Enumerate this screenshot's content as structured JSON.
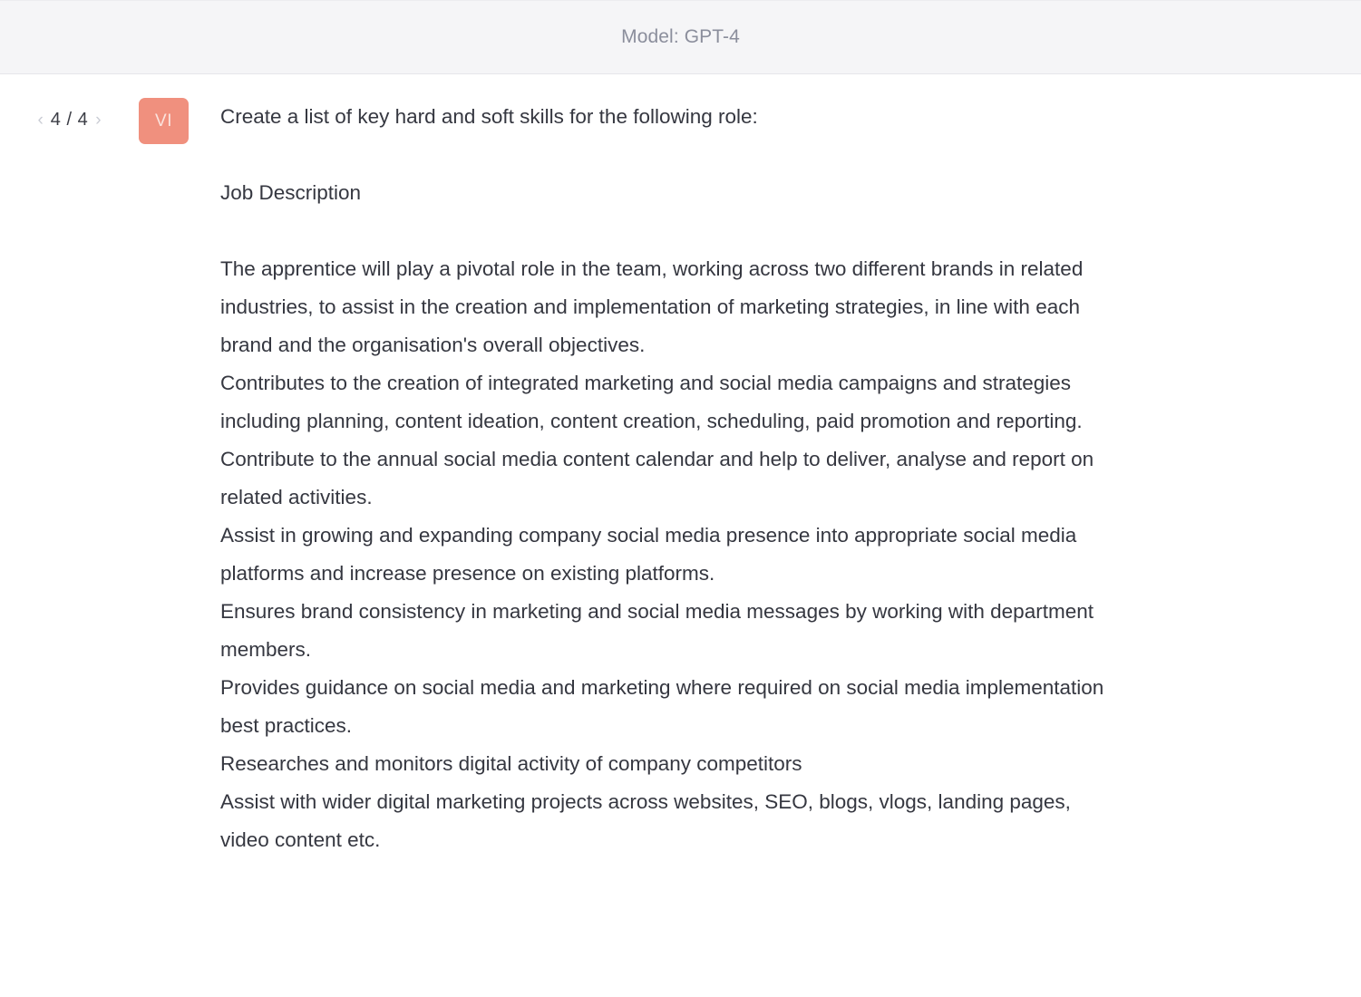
{
  "header": {
    "model_label": "Model: GPT-4"
  },
  "pagination": {
    "prev_icon": "chevron-left-icon",
    "prev_glyph": "‹",
    "next_icon": "chevron-right-icon",
    "next_glyph": "›",
    "count": "4 / 4",
    "current": 4,
    "total": 4
  },
  "message": {
    "avatar_initials": "VI",
    "avatar_color": "#f0907e",
    "prompt": "Create a list of key hard and soft skills for the following role:",
    "section_heading": "Job Description",
    "paragraphs": [
      "The apprentice will play a pivotal role in the team, working across two different brands in related industries, to assist in the creation and implementation of marketing strategies, in line with each brand and the organisation's overall objectives.",
      "Contributes to the creation of integrated marketing and social media campaigns and strategies including planning, content ideation, content creation, scheduling, paid promotion and reporting.",
      "Contribute to the annual social media content calendar and help to deliver, analyse and report on related activities.",
      "Assist in growing and expanding company social media presence into appropriate social media platforms and increase presence on existing platforms.",
      "Ensures brand consistency in marketing and social media messages by working with department members.",
      "Provides guidance on social media and marketing where required on social media implementation best practices.",
      "Researches and monitors digital activity of company competitors",
      "Assist with wider digital marketing projects across websites, SEO, blogs, vlogs, landing pages, video content etc."
    ]
  },
  "colors": {
    "header_bg": "#f5f5f7",
    "header_text": "#8b8e9c",
    "body_text": "#353740",
    "accent": "#f0907e",
    "page_bg": "#ffffff"
  }
}
